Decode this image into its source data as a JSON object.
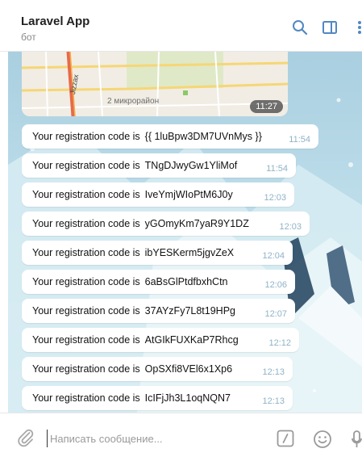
{
  "header": {
    "title": "Laravel App",
    "subtitle": "бот"
  },
  "map": {
    "district_label": "2 микрорайон",
    "street_label": "Jizzax",
    "time": "11:27"
  },
  "messages": [
    {
      "prefix": "Your registration code is",
      "code": "{{ 1luBpw3DM7UVnMys }}",
      "time": "11:54"
    },
    {
      "prefix": "Your registration code is",
      "code": "TNgDJwyGw1YliMof",
      "time": "11:54"
    },
    {
      "prefix": "Your registration code is",
      "code": "IveYmjWIoPtM6J0y",
      "time": "12:03"
    },
    {
      "prefix": "Your registration code is",
      "code": "yGOmyKm7yaR9Y1DZ",
      "time": "12:03"
    },
    {
      "prefix": "Your registration code is",
      "code": "ibYESKerm5jgvZeX",
      "time": "12:04"
    },
    {
      "prefix": "Your registration code is",
      "code": "6aBsGlPtdfbxhCtn",
      "time": "12:06"
    },
    {
      "prefix": "Your registration code is",
      "code": "37AYzFy7L8t19HPg",
      "time": "12:07"
    },
    {
      "prefix": "Your registration code is",
      "code": "AtGIkFUXKaP7Rhcg",
      "time": "12:12"
    },
    {
      "prefix": "Your registration code is",
      "code": "OpSXfi8VEl6x1Xp6",
      "time": "12:13"
    },
    {
      "prefix": "Your registration code is",
      "code": "IcIFjJh3L1oqNQN7",
      "time": "12:13"
    }
  ],
  "input": {
    "placeholder": "Написать сообщение..."
  },
  "icons": {
    "search": "search-icon",
    "sidebar": "sidebar-toggle-icon",
    "more": "more-vertical-icon",
    "attach": "paperclip-icon",
    "commands": "bot-commands-icon",
    "emoji": "emoji-icon",
    "mic": "microphone-icon"
  },
  "colors": {
    "accent": "#5288c1",
    "time_text": "#8fb3c8",
    "chat_bg": "#bcdce9"
  }
}
